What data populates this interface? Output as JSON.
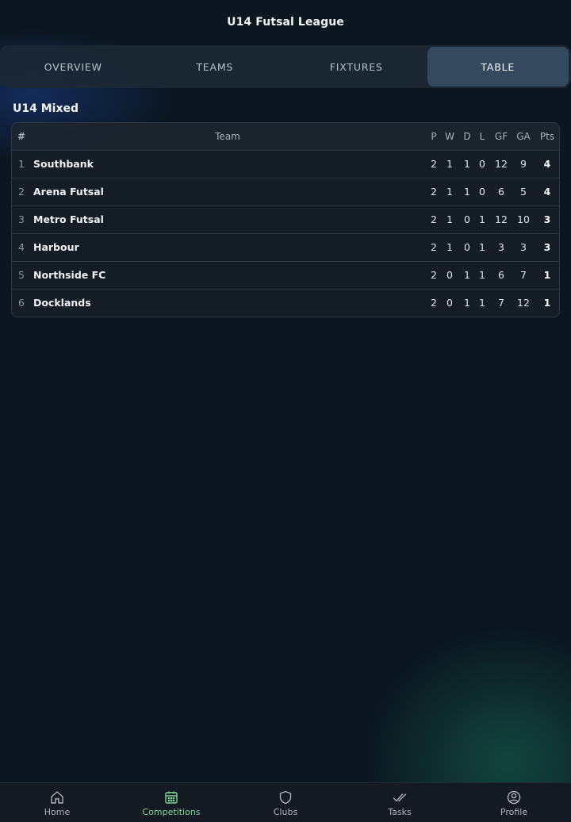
{
  "header": {
    "title": "U14 Futsal League"
  },
  "tabs": [
    {
      "label": "OVERVIEW",
      "active": false
    },
    {
      "label": "TEAMS",
      "active": false
    },
    {
      "label": "FIXTURES",
      "active": false
    },
    {
      "label": "TABLE",
      "active": true
    }
  ],
  "section": {
    "title": "U14 Mixed"
  },
  "table": {
    "columns": {
      "pos": "#",
      "team": "Team",
      "p": "P",
      "w": "W",
      "d": "D",
      "l": "L",
      "gf": "GF",
      "ga": "GA",
      "pts": "Pts"
    },
    "rows": [
      {
        "pos": "1",
        "team": "Southbank",
        "p": "2",
        "w": "1",
        "d": "1",
        "l": "0",
        "gf": "12",
        "ga": "9",
        "pts": "4"
      },
      {
        "pos": "2",
        "team": "Arena Futsal",
        "p": "2",
        "w": "1",
        "d": "1",
        "l": "0",
        "gf": "6",
        "ga": "5",
        "pts": "4"
      },
      {
        "pos": "3",
        "team": "Metro Futsal",
        "p": "2",
        "w": "1",
        "d": "0",
        "l": "1",
        "gf": "12",
        "ga": "10",
        "pts": "3"
      },
      {
        "pos": "4",
        "team": "Harbour",
        "p": "2",
        "w": "1",
        "d": "0",
        "l": "1",
        "gf": "3",
        "ga": "3",
        "pts": "3"
      },
      {
        "pos": "5",
        "team": "Northside FC",
        "p": "2",
        "w": "0",
        "d": "1",
        "l": "1",
        "gf": "6",
        "ga": "7",
        "pts": "1"
      },
      {
        "pos": "6",
        "team": "Docklands",
        "p": "2",
        "w": "0",
        "d": "1",
        "l": "1",
        "gf": "7",
        "ga": "12",
        "pts": "1"
      }
    ]
  },
  "nav": {
    "items": [
      {
        "label": "Home",
        "icon": "home-icon",
        "active": false
      },
      {
        "label": "Competitions",
        "icon": "calendar-icon",
        "active": true
      },
      {
        "label": "Clubs",
        "icon": "shield-icon",
        "active": false
      },
      {
        "label": "Tasks",
        "icon": "double-check-icon",
        "active": false
      },
      {
        "label": "Profile",
        "icon": "user-circle-icon",
        "active": false
      }
    ]
  },
  "colors": {
    "background": "#0b1620",
    "accent_active_nav": "#7fd89a",
    "active_tab": "#34495d"
  }
}
